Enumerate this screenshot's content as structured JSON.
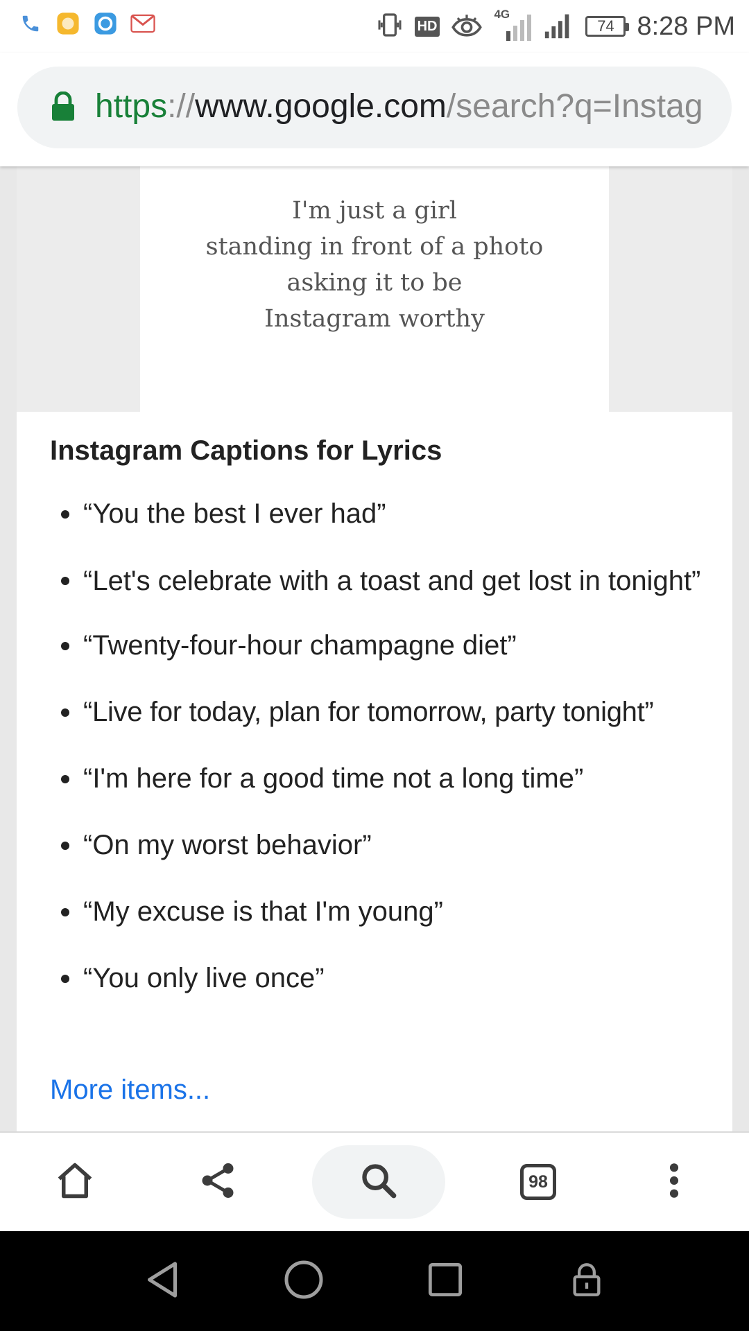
{
  "status_bar": {
    "time": "8:28 PM",
    "battery_level": "74",
    "hd_badge": "HD",
    "network_label": "4G",
    "left_icons": [
      "phone-icon",
      "hand-app-icon",
      "circle-app-icon",
      "gmail-icon"
    ],
    "right_icons": [
      "vibrate-icon",
      "hd-icon",
      "eye-icon",
      "signal-4g-icon",
      "signal-icon",
      "battery-icon"
    ]
  },
  "url_bar": {
    "scheme": "https",
    "separator": "://",
    "host": "www.google.com",
    "path": "/search?q=Instag",
    "secure_color": "#188038"
  },
  "image": {
    "quote_lines": [
      "I'm just a girl",
      "standing in front of a photo",
      "asking it to be",
      "Instagram worthy"
    ]
  },
  "section": {
    "title": "Instagram Captions for Lyrics",
    "items": [
      "“You the best I ever had”",
      "“Let's celebrate with a toast and get lost in tonight”",
      "“Twenty-four-hour champagne diet”",
      "“Live for today, plan for tomorrow, party tonight”",
      "“I'm here for a good time not a long time”",
      "“On my worst behavior”",
      "“My excuse is that I'm young”",
      "“You only live once”"
    ],
    "more_link": "More items...",
    "link_color": "#1a73e8"
  },
  "toolbar": {
    "tab_count": "98",
    "icons": [
      "home-icon",
      "share-icon",
      "search-icon",
      "tabs-icon",
      "more-vert-icon"
    ]
  },
  "nav_bar": {
    "icons": [
      "back-icon",
      "home-circle-icon",
      "recents-icon",
      "lock-icon"
    ]
  }
}
